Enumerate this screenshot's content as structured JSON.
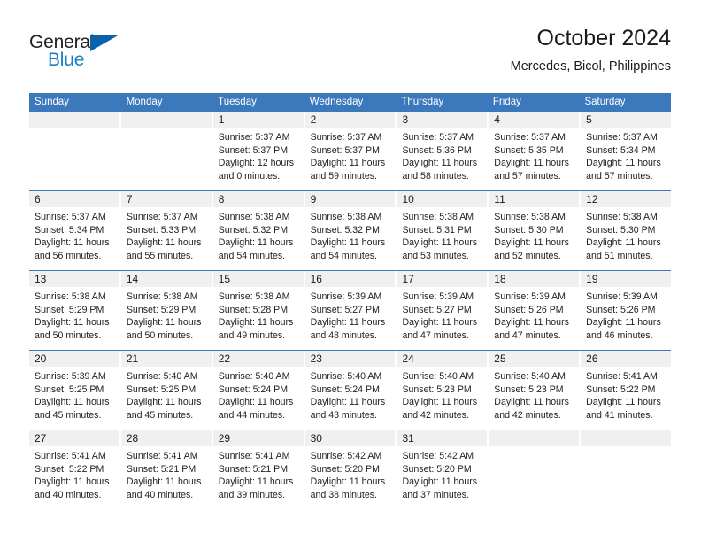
{
  "brand": {
    "name_part1": "General",
    "name_part2": "Blue",
    "triangle_color": "#0a62ab",
    "blue_text_color": "#1b7fc4"
  },
  "header": {
    "title": "October 2024",
    "subtitle": "Mercedes, Bicol, Philippines"
  },
  "theme": {
    "header_blue": "#3b78bc",
    "date_band_gray": "#f0f0f0",
    "text_color": "#222222"
  },
  "weekdays": [
    "Sunday",
    "Monday",
    "Tuesday",
    "Wednesday",
    "Thursday",
    "Friday",
    "Saturday"
  ],
  "weeks": [
    {
      "dates": [
        "",
        "",
        "1",
        "2",
        "3",
        "4",
        "5"
      ],
      "cells": [
        {
          "lines": []
        },
        {
          "lines": []
        },
        {
          "lines": [
            "Sunrise: 5:37 AM",
            "Sunset: 5:37 PM",
            "Daylight: 12 hours",
            "and 0 minutes."
          ]
        },
        {
          "lines": [
            "Sunrise: 5:37 AM",
            "Sunset: 5:37 PM",
            "Daylight: 11 hours",
            "and 59 minutes."
          ]
        },
        {
          "lines": [
            "Sunrise: 5:37 AM",
            "Sunset: 5:36 PM",
            "Daylight: 11 hours",
            "and 58 minutes."
          ]
        },
        {
          "lines": [
            "Sunrise: 5:37 AM",
            "Sunset: 5:35 PM",
            "Daylight: 11 hours",
            "and 57 minutes."
          ]
        },
        {
          "lines": [
            "Sunrise: 5:37 AM",
            "Sunset: 5:34 PM",
            "Daylight: 11 hours",
            "and 57 minutes."
          ]
        }
      ]
    },
    {
      "dates": [
        "6",
        "7",
        "8",
        "9",
        "10",
        "11",
        "12"
      ],
      "cells": [
        {
          "lines": [
            "Sunrise: 5:37 AM",
            "Sunset: 5:34 PM",
            "Daylight: 11 hours",
            "and 56 minutes."
          ]
        },
        {
          "lines": [
            "Sunrise: 5:37 AM",
            "Sunset: 5:33 PM",
            "Daylight: 11 hours",
            "and 55 minutes."
          ]
        },
        {
          "lines": [
            "Sunrise: 5:38 AM",
            "Sunset: 5:32 PM",
            "Daylight: 11 hours",
            "and 54 minutes."
          ]
        },
        {
          "lines": [
            "Sunrise: 5:38 AM",
            "Sunset: 5:32 PM",
            "Daylight: 11 hours",
            "and 54 minutes."
          ]
        },
        {
          "lines": [
            "Sunrise: 5:38 AM",
            "Sunset: 5:31 PM",
            "Daylight: 11 hours",
            "and 53 minutes."
          ]
        },
        {
          "lines": [
            "Sunrise: 5:38 AM",
            "Sunset: 5:30 PM",
            "Daylight: 11 hours",
            "and 52 minutes."
          ]
        },
        {
          "lines": [
            "Sunrise: 5:38 AM",
            "Sunset: 5:30 PM",
            "Daylight: 11 hours",
            "and 51 minutes."
          ]
        }
      ]
    },
    {
      "dates": [
        "13",
        "14",
        "15",
        "16",
        "17",
        "18",
        "19"
      ],
      "cells": [
        {
          "lines": [
            "Sunrise: 5:38 AM",
            "Sunset: 5:29 PM",
            "Daylight: 11 hours",
            "and 50 minutes."
          ]
        },
        {
          "lines": [
            "Sunrise: 5:38 AM",
            "Sunset: 5:29 PM",
            "Daylight: 11 hours",
            "and 50 minutes."
          ]
        },
        {
          "lines": [
            "Sunrise: 5:38 AM",
            "Sunset: 5:28 PM",
            "Daylight: 11 hours",
            "and 49 minutes."
          ]
        },
        {
          "lines": [
            "Sunrise: 5:39 AM",
            "Sunset: 5:27 PM",
            "Daylight: 11 hours",
            "and 48 minutes."
          ]
        },
        {
          "lines": [
            "Sunrise: 5:39 AM",
            "Sunset: 5:27 PM",
            "Daylight: 11 hours",
            "and 47 minutes."
          ]
        },
        {
          "lines": [
            "Sunrise: 5:39 AM",
            "Sunset: 5:26 PM",
            "Daylight: 11 hours",
            "and 47 minutes."
          ]
        },
        {
          "lines": [
            "Sunrise: 5:39 AM",
            "Sunset: 5:26 PM",
            "Daylight: 11 hours",
            "and 46 minutes."
          ]
        }
      ]
    },
    {
      "dates": [
        "20",
        "21",
        "22",
        "23",
        "24",
        "25",
        "26"
      ],
      "cells": [
        {
          "lines": [
            "Sunrise: 5:39 AM",
            "Sunset: 5:25 PM",
            "Daylight: 11 hours",
            "and 45 minutes."
          ]
        },
        {
          "lines": [
            "Sunrise: 5:40 AM",
            "Sunset: 5:25 PM",
            "Daylight: 11 hours",
            "and 45 minutes."
          ]
        },
        {
          "lines": [
            "Sunrise: 5:40 AM",
            "Sunset: 5:24 PM",
            "Daylight: 11 hours",
            "and 44 minutes."
          ]
        },
        {
          "lines": [
            "Sunrise: 5:40 AM",
            "Sunset: 5:24 PM",
            "Daylight: 11 hours",
            "and 43 minutes."
          ]
        },
        {
          "lines": [
            "Sunrise: 5:40 AM",
            "Sunset: 5:23 PM",
            "Daylight: 11 hours",
            "and 42 minutes."
          ]
        },
        {
          "lines": [
            "Sunrise: 5:40 AM",
            "Sunset: 5:23 PM",
            "Daylight: 11 hours",
            "and 42 minutes."
          ]
        },
        {
          "lines": [
            "Sunrise: 5:41 AM",
            "Sunset: 5:22 PM",
            "Daylight: 11 hours",
            "and 41 minutes."
          ]
        }
      ]
    },
    {
      "dates": [
        "27",
        "28",
        "29",
        "30",
        "31",
        "",
        ""
      ],
      "cells": [
        {
          "lines": [
            "Sunrise: 5:41 AM",
            "Sunset: 5:22 PM",
            "Daylight: 11 hours",
            "and 40 minutes."
          ]
        },
        {
          "lines": [
            "Sunrise: 5:41 AM",
            "Sunset: 5:21 PM",
            "Daylight: 11 hours",
            "and 40 minutes."
          ]
        },
        {
          "lines": [
            "Sunrise: 5:41 AM",
            "Sunset: 5:21 PM",
            "Daylight: 11 hours",
            "and 39 minutes."
          ]
        },
        {
          "lines": [
            "Sunrise: 5:42 AM",
            "Sunset: 5:20 PM",
            "Daylight: 11 hours",
            "and 38 minutes."
          ]
        },
        {
          "lines": [
            "Sunrise: 5:42 AM",
            "Sunset: 5:20 PM",
            "Daylight: 11 hours",
            "and 37 minutes."
          ]
        },
        {
          "lines": []
        },
        {
          "lines": []
        }
      ]
    }
  ]
}
